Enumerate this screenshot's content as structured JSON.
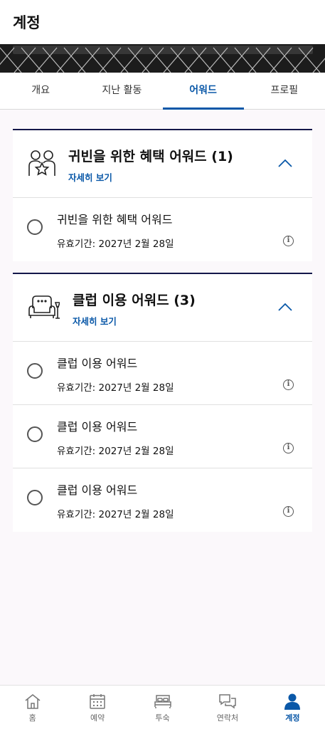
{
  "header": {
    "title": "계정"
  },
  "tabs": [
    {
      "label": "개요"
    },
    {
      "label": "지난 활동"
    },
    {
      "label": "어워드"
    },
    {
      "label": "프로필"
    }
  ],
  "active_tab": "어워드",
  "cards": [
    {
      "icon": "people-star-icon",
      "title": "귀빈을 위한 혜택 어워드 (1)",
      "detail_link": "자세히 보기",
      "items": [
        {
          "name": "귀빈을 위한 혜택 어워드",
          "expiry": "유효기간: 2027년 2월 28일"
        }
      ]
    },
    {
      "icon": "armchair-icon",
      "title": "클럽 이용 어워드 (3)",
      "detail_link": "자세히 보기",
      "items": [
        {
          "name": "클럽 이용 어워드",
          "expiry": "유효기간: 2027년 2월 28일"
        },
        {
          "name": "클럽 이용 어워드",
          "expiry": "유효기간: 2027년 2월 28일"
        },
        {
          "name": "클럽 이용 어워드",
          "expiry": "유효기간: 2027년 2월 28일"
        }
      ]
    }
  ],
  "bottom_nav": [
    {
      "label": "홈",
      "icon": "home-icon"
    },
    {
      "label": "예약",
      "icon": "calendar-icon"
    },
    {
      "label": "투숙",
      "icon": "bed-icon"
    },
    {
      "label": "연락처",
      "icon": "chat-icon"
    },
    {
      "label": "계정",
      "icon": "person-icon",
      "active": true
    }
  ],
  "colors": {
    "accent": "#0a58a8",
    "card_border": "#14174a",
    "background": "#fbf8fb"
  }
}
